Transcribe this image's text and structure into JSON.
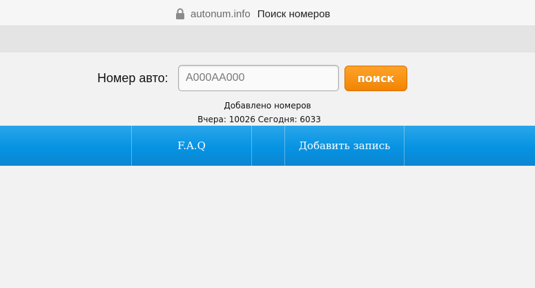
{
  "browser": {
    "domain": "autonum.info",
    "page_title": "Поиск номеров",
    "lock_icon": "lock-icon"
  },
  "search": {
    "label": "Номер авто:",
    "placeholder": "А000АА000",
    "value": "",
    "button_label": "поиск",
    "button_color": "#f28400"
  },
  "stats": {
    "title": "Добавлено номеров",
    "summary": "Вчера: 10026 Сегодня: 6033"
  },
  "nav": {
    "accent": "#0693e3",
    "items": [
      {
        "label": "F.A.Q"
      },
      {
        "label": "Добавить запись"
      }
    ]
  }
}
